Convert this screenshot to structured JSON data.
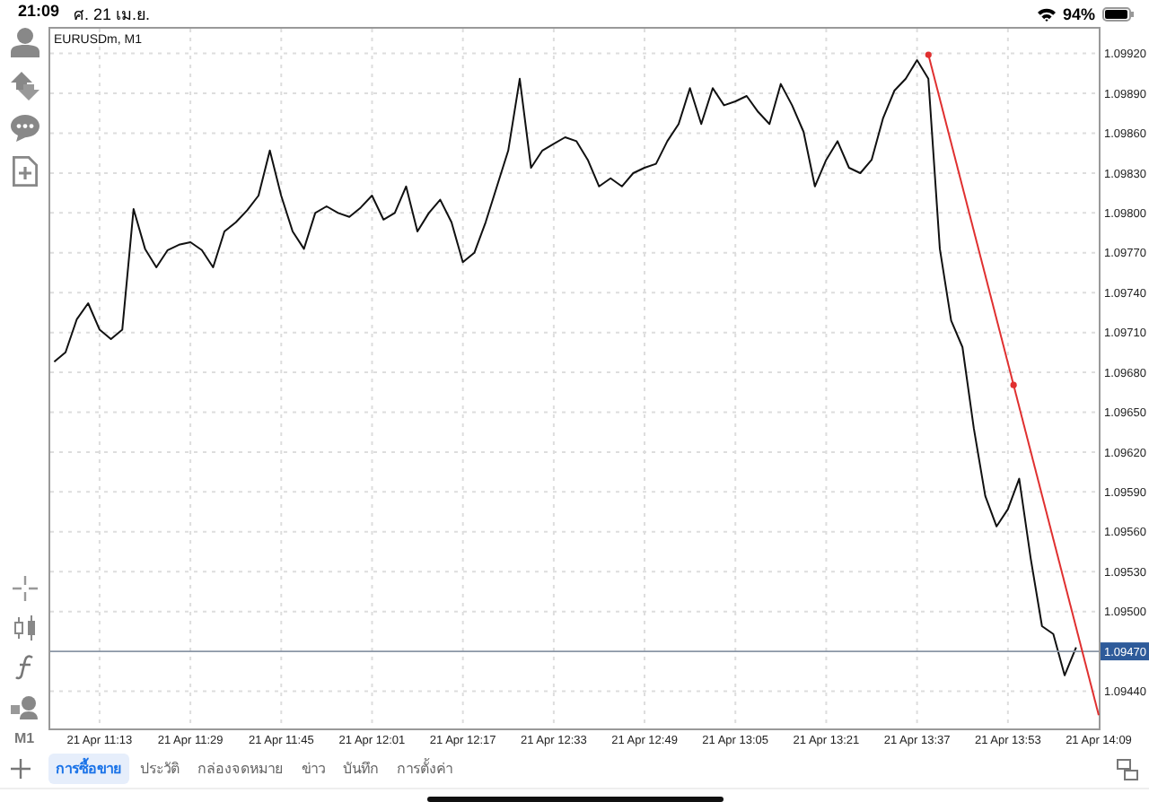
{
  "status_bar": {
    "time": "21:09",
    "date": "ศ. 21 เม.ย.",
    "battery": "94%"
  },
  "sidebar": {
    "timeframe": "M1"
  },
  "chart": {
    "title": "EURUSDm, M1",
    "price_tag": "1.09470",
    "chart_data": {
      "type": "line",
      "grid": true,
      "ylim": [
        1.09412,
        1.0994
      ],
      "categories": [
        null,
        null,
        null,
        null,
        "21 Apr 11:13",
        null,
        null,
        null,
        null,
        null,
        null,
        null,
        "21 Apr 11:29",
        null,
        null,
        null,
        null,
        null,
        null,
        null,
        "21 Apr 11:45",
        null,
        null,
        null,
        null,
        null,
        null,
        null,
        "21 Apr 12:01",
        null,
        null,
        null,
        null,
        null,
        null,
        null,
        "21 Apr 12:17",
        null,
        null,
        null,
        null,
        null,
        null,
        null,
        "21 Apr 12:33",
        null,
        null,
        null,
        null,
        null,
        null,
        null,
        "21 Apr 12:49",
        null,
        null,
        null,
        null,
        null,
        null,
        null,
        "21 Apr 13:05",
        null,
        null,
        null,
        null,
        null,
        null,
        null,
        "21 Apr 13:21",
        null,
        null,
        null,
        null,
        null,
        null,
        null,
        "21 Apr 13:37",
        null,
        null,
        null,
        null,
        null,
        null,
        null,
        "21 Apr 13:53",
        null,
        null,
        null,
        null,
        null,
        null,
        null,
        "21 Apr 14:09"
      ],
      "yticks": [
        {
          "value": 1.0992,
          "label": "1.09920"
        },
        {
          "value": 1.0989,
          "label": "1.09890"
        },
        {
          "value": 1.0986,
          "label": "1.09860"
        },
        {
          "value": 1.0983,
          "label": "1.09830"
        },
        {
          "value": 1.098,
          "label": "1.09800"
        },
        {
          "value": 1.0977,
          "label": "1.09770"
        },
        {
          "value": 1.0974,
          "label": "1.09740"
        },
        {
          "value": 1.0971,
          "label": "1.09710"
        },
        {
          "value": 1.0968,
          "label": "1.09680"
        },
        {
          "value": 1.0965,
          "label": "1.09650"
        },
        {
          "value": 1.0962,
          "label": "1.09620"
        },
        {
          "value": 1.0959,
          "label": "1.09590"
        },
        {
          "value": 1.0956,
          "label": "1.09560"
        },
        {
          "value": 1.0953,
          "label": "1.09530"
        },
        {
          "value": 1.095,
          "label": "1.09500"
        },
        {
          "value": 1.0944,
          "label": "1.09440"
        }
      ],
      "series": [
        {
          "color": "#111111",
          "values": [
            1.09688,
            1.09695,
            1.0972,
            1.09732,
            1.09712,
            1.09705,
            1.09712,
            1.09803,
            1.09773,
            1.09759,
            1.09772,
            1.09776,
            1.09778,
            1.09772,
            1.09759,
            1.09786,
            1.09793,
            1.09802,
            1.09813,
            1.09847,
            1.09813,
            1.09786,
            1.09773,
            1.098,
            1.09805,
            1.098,
            1.09797,
            1.09804,
            1.09813,
            1.09795,
            1.098,
            1.0982,
            1.09786,
            1.098,
            1.0981,
            1.09793,
            1.09763,
            1.0977,
            1.09793,
            1.0982,
            1.09847,
            1.09901,
            1.09834,
            1.09847,
            1.09852,
            1.09857,
            1.09854,
            1.0984,
            1.0982,
            1.09826,
            1.0982,
            1.0983,
            1.09834,
            1.09837,
            1.09854,
            1.09867,
            1.09894,
            1.09867,
            1.09894,
            1.09881,
            1.09884,
            1.09888,
            1.09876,
            1.09867,
            1.09897,
            1.09881,
            1.09861,
            1.0982,
            1.0984,
            1.09854,
            1.09834,
            1.0983,
            1.0984,
            1.09871,
            1.09892,
            1.09901,
            1.09915,
            1.09901,
            1.09773,
            1.09719,
            1.09699,
            1.09638,
            1.09587,
            1.09564,
            1.09577,
            1.096,
            1.0954,
            1.09489,
            1.09483,
            1.09452,
            1.09473,
            null,
            null
          ]
        }
      ]
    }
  },
  "tabs": [
    {
      "label": "การซื้อขาย",
      "selected": true
    },
    {
      "label": "ประวัติ",
      "selected": false
    },
    {
      "label": "กล่องจดหมาย",
      "selected": false
    },
    {
      "label": "ข่าว",
      "selected": false
    },
    {
      "label": "บันทึก",
      "selected": false
    },
    {
      "label": "การตั้งค่า",
      "selected": false
    }
  ]
}
